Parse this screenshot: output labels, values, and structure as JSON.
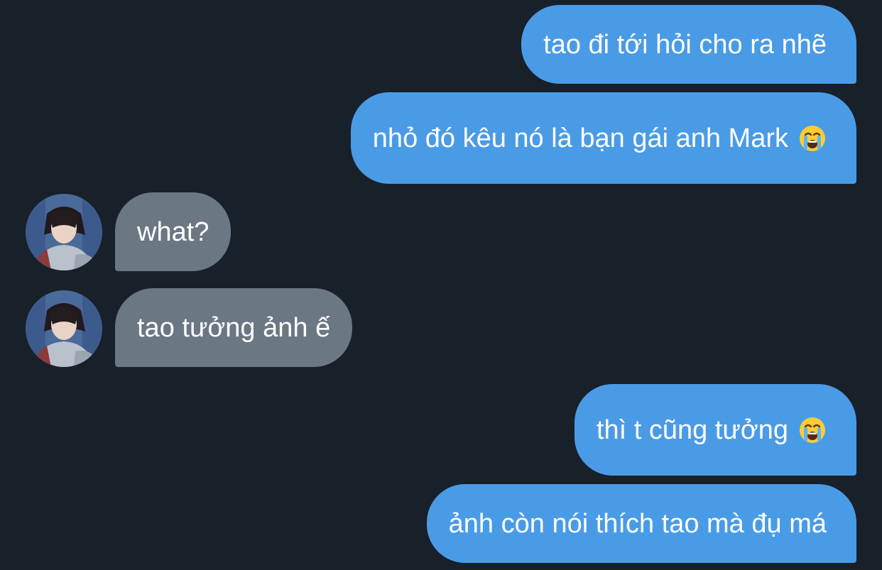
{
  "conversation": {
    "messages": [
      {
        "side": "sent",
        "text": "tao đi tới hỏi cho ra nhẽ",
        "emoji": ""
      },
      {
        "side": "sent",
        "text": "nhỏ đó kêu nó là bạn gái anh Mark",
        "emoji": "loudly-crying-face"
      },
      {
        "side": "received",
        "text": "what?",
        "emoji": ""
      },
      {
        "side": "received",
        "text": "tao tưởng ảnh ế",
        "emoji": ""
      },
      {
        "side": "sent",
        "text": "thì t cũng tưởng",
        "emoji": "loudly-crying-face"
      },
      {
        "side": "sent",
        "text": "ảnh còn nói thích tao mà đụ má",
        "emoji": ""
      }
    ]
  },
  "colors": {
    "background": "#18202a",
    "sent_bubble": "#4a9be6",
    "received_bubble": "#6b7783",
    "text": "#ffffff"
  },
  "icons": {
    "emoji": "loudly-crying-face",
    "avatar": "contact-avatar-photo"
  }
}
